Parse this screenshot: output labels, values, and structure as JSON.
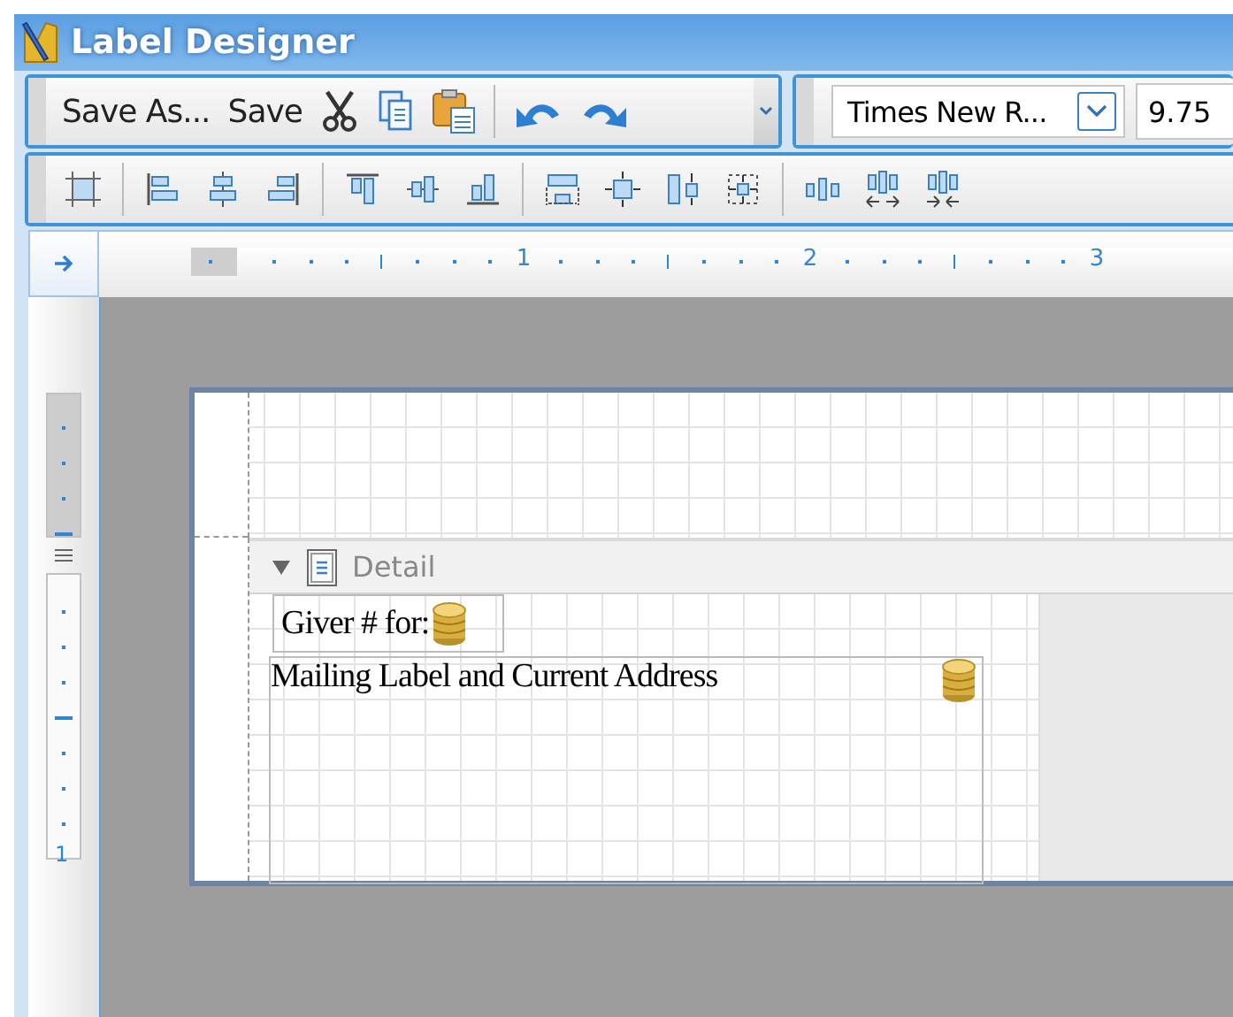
{
  "window": {
    "title": "Label Designer"
  },
  "toolbar": {
    "buttons": [
      {
        "label": "Save As..."
      },
      {
        "label": "Save"
      }
    ],
    "font": {
      "value": "Times New R..."
    },
    "font_size": {
      "value": "9.75"
    }
  },
  "ruler": {
    "labels": [
      "1",
      "2",
      "3"
    ]
  },
  "vertical_ruler": {
    "labels": [
      "1"
    ]
  },
  "band": {
    "title": "Detail",
    "expanded": true
  },
  "fields": [
    {
      "text": "Giver # for:"
    },
    {
      "text": "Mailing Label and Current Address"
    }
  ]
}
